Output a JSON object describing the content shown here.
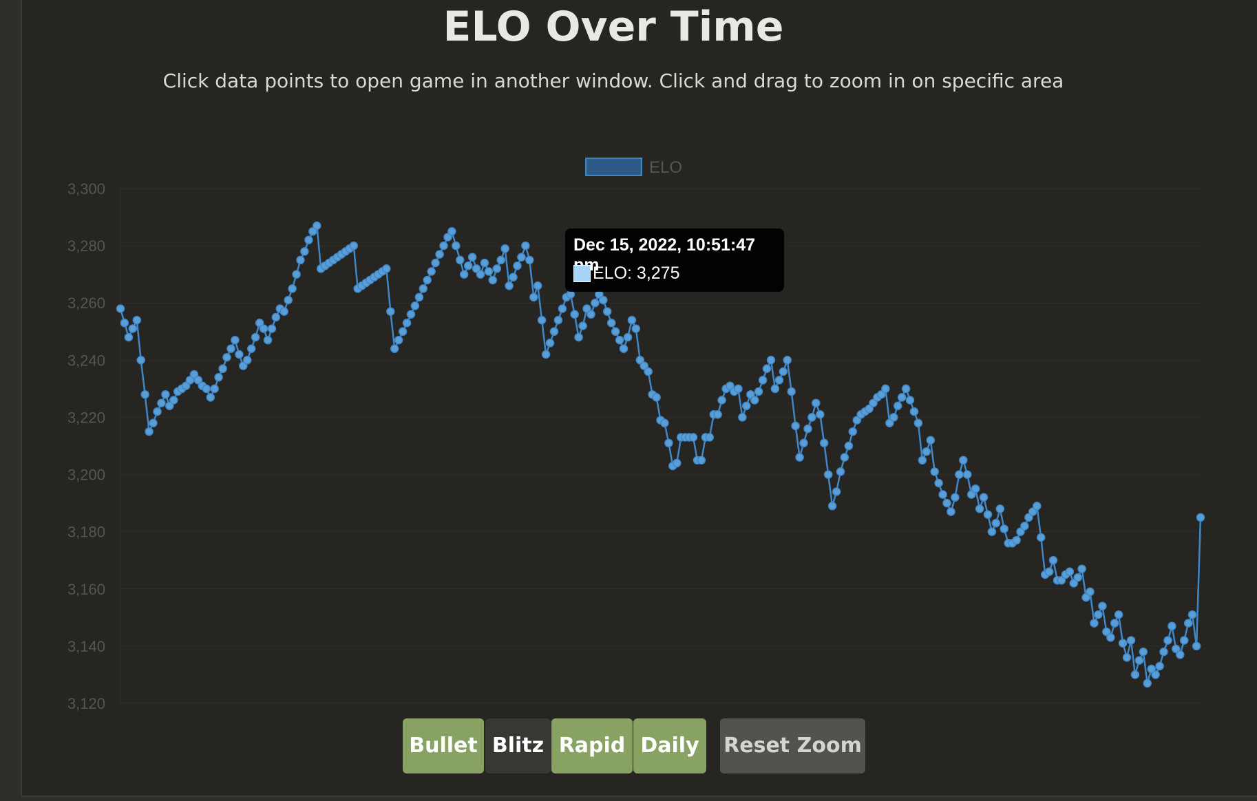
{
  "header": {
    "title": "ELO Over Time",
    "subtitle": "Click data points to open game in another window. Click and drag to zoom in on specific area"
  },
  "colors": {
    "line": "#3f87c9",
    "point_fill": "#5a9ed6",
    "legend_fill": "#2c5b87",
    "active_button": "#87a262",
    "inactive_button": "#383734",
    "reset_button": "#53524f"
  },
  "tooltip": {
    "title": "Dec 15, 2022, 10:51:47 pm",
    "series_label": "ELO",
    "value": "3,275",
    "body": "ELO: 3,275"
  },
  "buttons": [
    {
      "label": "Bullet",
      "active": true
    },
    {
      "label": "Blitz",
      "active": false
    },
    {
      "label": "Rapid",
      "active": true
    },
    {
      "label": "Daily",
      "active": true
    }
  ],
  "reset_label": "Reset Zoom",
  "chart_data": {
    "type": "line",
    "title": "",
    "xlabel": "",
    "ylabel": "",
    "ylim": [
      3120,
      3300
    ],
    "yticks": [
      3120,
      3140,
      3160,
      3180,
      3200,
      3220,
      3240,
      3260,
      3280,
      3300
    ],
    "ytick_labels": [
      "3,120",
      "3,140",
      "3,160",
      "3,180",
      "3,200",
      "3,220",
      "3,240",
      "3,260",
      "3,280",
      "3,300"
    ],
    "grid": true,
    "legend_position": "top",
    "series": [
      {
        "name": "ELO",
        "values": [
          3258,
          3253,
          3248,
          3251,
          3254,
          3240,
          3228,
          3215,
          3218,
          3222,
          3225,
          3228,
          3224,
          3226,
          3229,
          3230,
          3231,
          3233,
          3235,
          3233,
          3231,
          3230,
          3227,
          3230,
          3234,
          3237,
          3241,
          3244,
          3247,
          3242,
          3238,
          3240,
          3244,
          3248,
          3253,
          3251,
          3247,
          3251,
          3255,
          3258,
          3257,
          3261,
          3265,
          3270,
          3275,
          3278,
          3282,
          3285,
          3287,
          3272,
          3273,
          3274,
          3275,
          3276,
          3277,
          3278,
          3279,
          3280,
          3265,
          3266,
          3267,
          3268,
          3269,
          3270,
          3271,
          3272,
          3257,
          3244,
          3247,
          3250,
          3253,
          3256,
          3259,
          3262,
          3265,
          3268,
          3271,
          3274,
          3277,
          3280,
          3283,
          3285,
          3280,
          3275,
          3270,
          3273,
          3276,
          3272,
          3270,
          3274,
          3271,
          3268,
          3272,
          3275,
          3279,
          3266,
          3269,
          3273,
          3276,
          3280,
          3275,
          3262,
          3266,
          3254,
          3242,
          3246,
          3250,
          3254,
          3258,
          3262,
          3263,
          3256,
          3248,
          3252,
          3258,
          3256,
          3260,
          3263,
          3261,
          3257,
          3253,
          3250,
          3247,
          3244,
          3248,
          3254,
          3251,
          3240,
          3238,
          3236,
          3228,
          3227,
          3219,
          3218,
          3211,
          3203,
          3204,
          3213,
          3213,
          3213,
          3213,
          3205,
          3205,
          3213,
          3213,
          3221,
          3221,
          3226,
          3230,
          3231,
          3229,
          3230,
          3220,
          3224,
          3228,
          3226,
          3229,
          3233,
          3237,
          3240,
          3230,
          3233,
          3236,
          3240,
          3229,
          3217,
          3206,
          3211,
          3216,
          3220,
          3225,
          3221,
          3211,
          3200,
          3189,
          3194,
          3201,
          3206,
          3210,
          3215,
          3219,
          3221,
          3222,
          3223,
          3225,
          3227,
          3228,
          3230,
          3218,
          3220,
          3224,
          3227,
          3230,
          3226,
          3222,
          3218,
          3205,
          3208,
          3212,
          3201,
          3197,
          3193,
          3190,
          3187,
          3192,
          3200,
          3205,
          3200,
          3193,
          3195,
          3188,
          3192,
          3186,
          3180,
          3183,
          3188,
          3181,
          3176,
          3176,
          3177,
          3180,
          3182,
          3185,
          3187,
          3189,
          3178,
          3165,
          3166,
          3170,
          3163,
          3163,
          3165,
          3166,
          3162,
          3164,
          3167,
          3157,
          3159,
          3148,
          3151,
          3154,
          3145,
          3143,
          3148,
          3151,
          3141,
          3136,
          3142,
          3130,
          3135,
          3138,
          3127,
          3132,
          3130,
          3133,
          3138,
          3142,
          3147,
          3139,
          3137,
          3142,
          3148,
          3151,
          3140,
          3185
        ]
      }
    ]
  }
}
